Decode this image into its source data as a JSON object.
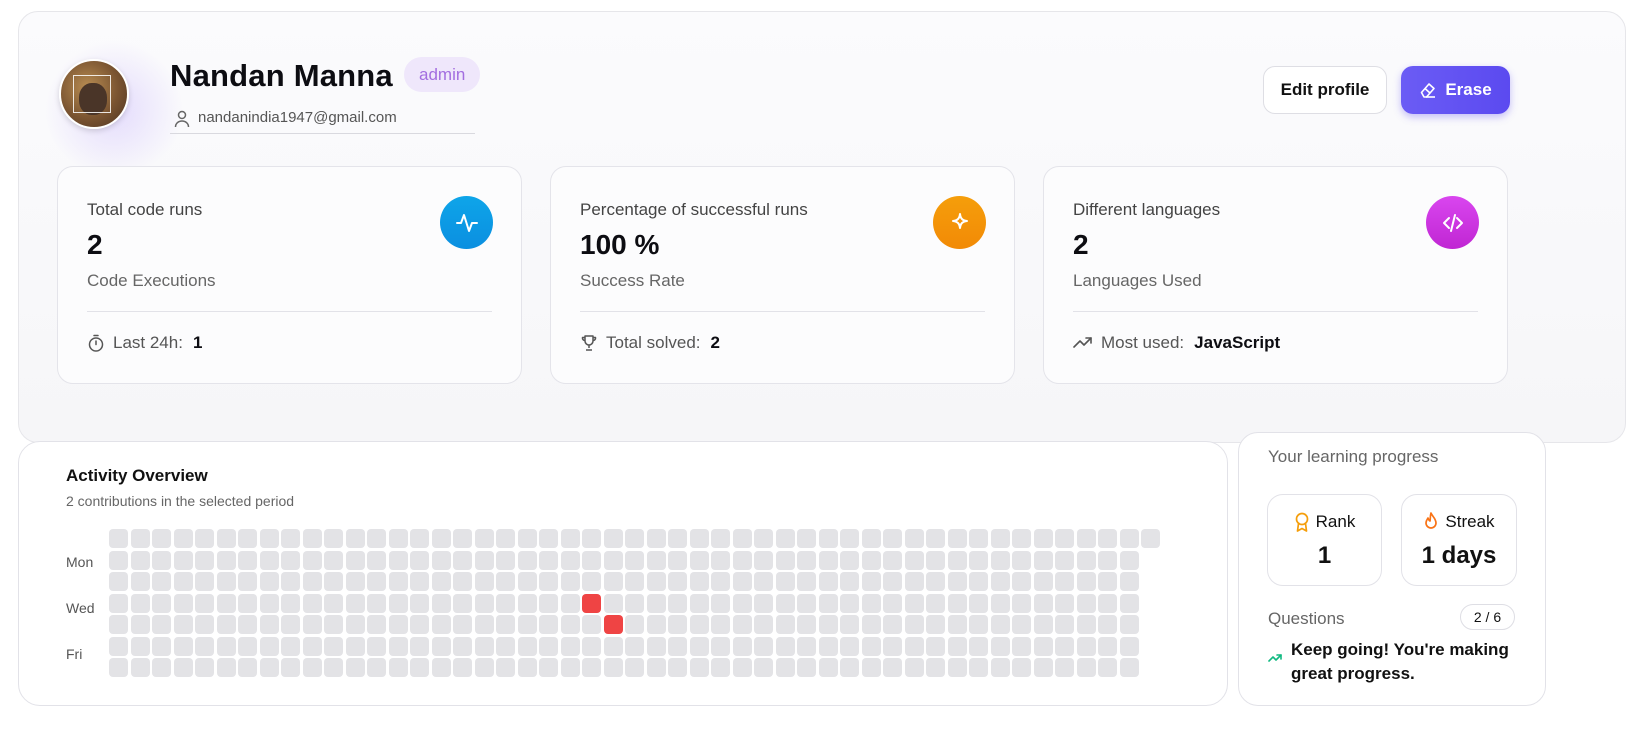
{
  "profile": {
    "name": "Nandan Manna",
    "role": "admin",
    "email": "nandanindia1947@gmail.com"
  },
  "actions": {
    "edit_label": "Edit profile",
    "erase_label": "Erase"
  },
  "stats": [
    {
      "title": "Total code runs",
      "value": "2",
      "subtitle": "Code Executions",
      "footer_label": "Last 24h:",
      "footer_value": "1",
      "icon": "activity-icon",
      "color": "#0ea5e9"
    },
    {
      "title": "Percentage of successful runs",
      "value": "100 %",
      "subtitle": "Success Rate",
      "footer_label": "Total solved:",
      "footer_value": "2",
      "icon": "sparkle-icon",
      "color": "#f59e0b"
    },
    {
      "title": "Different languages",
      "value": "2",
      "subtitle": "Languages Used",
      "footer_label": "Most used:",
      "footer_value": "JavaScript",
      "icon": "code-icon",
      "color": "#d946ef"
    }
  ],
  "activity": {
    "title": "Activity Overview",
    "subtitle": "2 contributions in the selected period",
    "day_labels": [
      "Mon",
      "Wed",
      "Fri"
    ],
    "weeks": 49,
    "active_cells": [
      {
        "week": 22,
        "day": 3
      },
      {
        "week": 23,
        "day": 4
      }
    ],
    "inactive_color": "#e3e3e6",
    "active_color": "#ef4444"
  },
  "progress": {
    "heading": "Your learning progress",
    "rank_label": "Rank",
    "rank_value": "1",
    "streak_label": "Streak",
    "streak_value": "1 days",
    "questions_label": "Questions",
    "questions_value": "2 / 6",
    "message": "Keep going! You're making great progress."
  },
  "colors": {
    "accent": "#5b4af0",
    "admin_badge_bg": "#efe7fb",
    "admin_badge_text": "#a36ee0"
  }
}
